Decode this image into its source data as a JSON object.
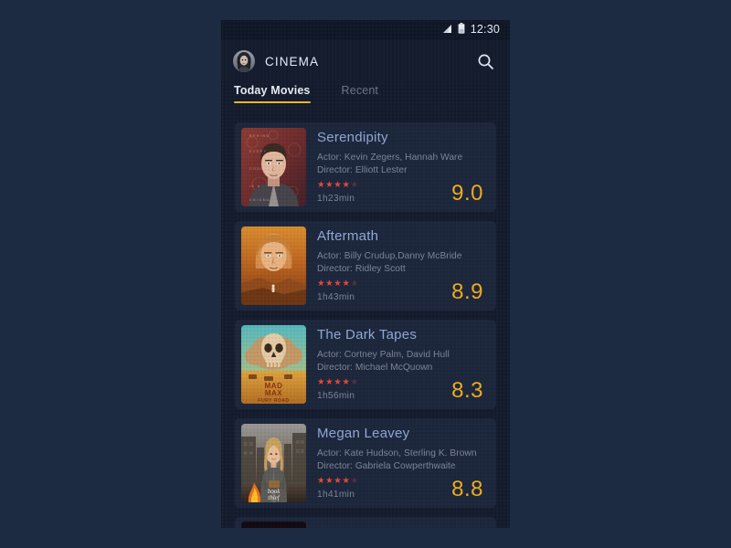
{
  "status_bar": {
    "time": "12:30",
    "signal_icon": "signal-bars-icon",
    "battery_icon": "battery-icon"
  },
  "app_bar": {
    "title": "CINEMA",
    "avatar_icon": "user-avatar",
    "search_icon": "search-icon"
  },
  "tabs": [
    {
      "label": "Today Movies",
      "active": true
    },
    {
      "label": "Recent",
      "active": false
    }
  ],
  "colors": {
    "page_background": "#1c2a42",
    "screen_background": "#141c2e",
    "status_bar": "#101828",
    "card_background": "#1d273c",
    "title": "#8fa8d8",
    "secondary_text": "#7d8698",
    "accent_underline": "#f0b429",
    "score": "#f0ad1e",
    "star_on": "#e24b3a",
    "star_off": "#4a3640"
  },
  "movies": [
    {
      "title": "Serendipity",
      "actor": "Actor: Kevin Zegers, Hannah Ware",
      "director": "Director: Elliott Lester",
      "stars_filled": 4,
      "stars_total": 5,
      "duration": "1h23min",
      "score": "9.0",
      "poster_name": "poster-serendipity"
    },
    {
      "title": "Aftermath",
      "actor": "Actor: Billy Crudup,Danny McBride",
      "director": "Director: Ridley Scott",
      "stars_filled": 4,
      "stars_total": 5,
      "duration": "1h43min",
      "score": "8.9",
      "poster_name": "poster-aftermath"
    },
    {
      "title": "The Dark Tapes",
      "actor": "Actor: Cortney Palm, David Hull",
      "director": "Director: Michael McQuown",
      "stars_filled": 4,
      "stars_total": 5,
      "duration": "1h56min",
      "score": "8.3",
      "poster_name": "poster-the-dark-tapes"
    },
    {
      "title": "Megan Leavey",
      "actor": "Actor: Kate Hudson, Sterling K. Brown",
      "director": "Director: Gabriela Cowperthwaite",
      "stars_filled": 4,
      "stars_total": 5,
      "duration": "1h41min",
      "score": "8.8",
      "poster_name": "poster-megan-leavey"
    },
    {
      "title": "",
      "actor": "",
      "director": "",
      "stars_filled": 0,
      "stars_total": 0,
      "duration": "",
      "score": "",
      "poster_name": "poster-partial"
    }
  ]
}
